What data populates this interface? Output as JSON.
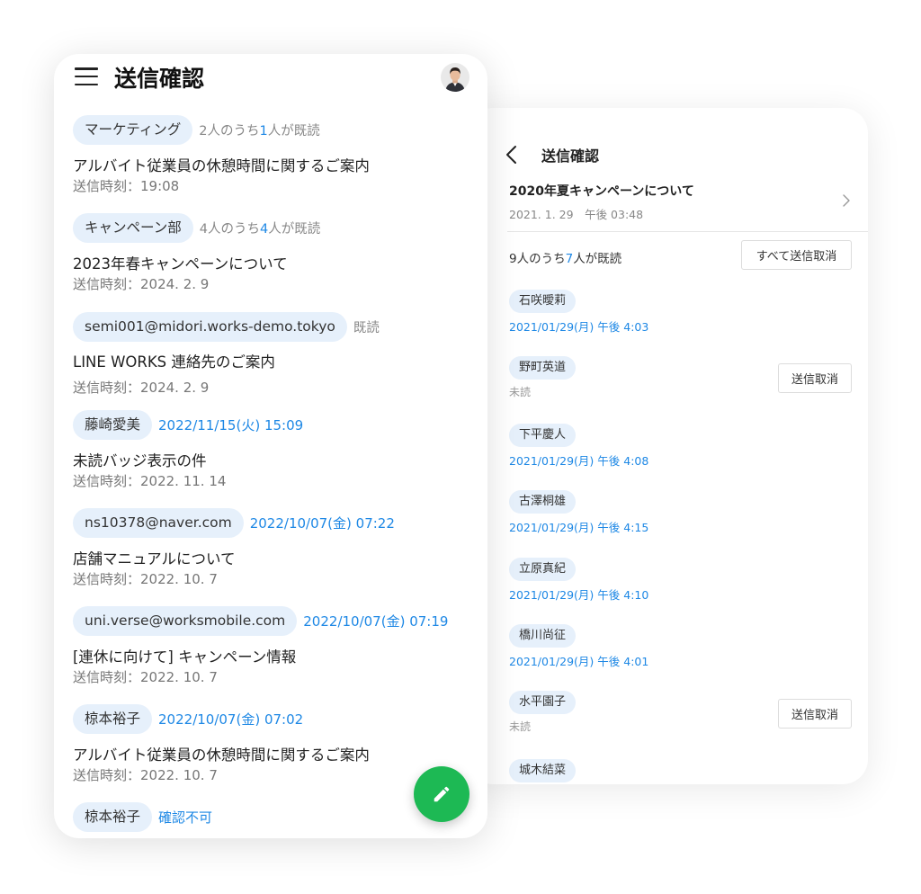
{
  "left_panel": {
    "title": "送信確認",
    "icons": {
      "menu": "hamburger-menu-icon",
      "avatar": "user-avatar",
      "compose": "pencil-icon"
    },
    "items": [
      {
        "recipient": "マーケティング",
        "status_pre": "2人のうち",
        "status_num": "1",
        "status_post": "人が既読",
        "subject": "アルバイト従業員の休憩時間に関するご案内",
        "sent": "送信時刻：19:08"
      },
      {
        "recipient": "キャンペーン部",
        "status_pre": "4人のうち",
        "status_num": "4",
        "status_post": "人が既読",
        "subject": "2023年春キャンペーンについて",
        "sent": "送信時刻：2024. 2. 9"
      },
      {
        "recipient": "semi001@midori.works-demo.tokyo",
        "status": "既読",
        "subject": "LINE WORKS 連絡先のご案内",
        "sent": "送信時刻：2024. 2. 9"
      },
      {
        "recipient": "藤崎愛美",
        "read_at": "2022/11/15(火) 15:09",
        "subject": "未読バッジ表示の件",
        "sent": "送信時刻：2022. 11. 14"
      },
      {
        "recipient": "ns10378@naver.com",
        "read_at": "2022/10/07(金) 07:22",
        "subject": "店舗マニュアルについて",
        "sent": "送信時刻：2022. 10. 7"
      },
      {
        "recipient": "uni.verse@worksmobile.com",
        "read_at": "2022/10/07(金) 07:19",
        "subject": "[連休に向けて] キャンペーン情報",
        "sent": "送信時刻：2022. 10. 7"
      },
      {
        "recipient": "椋本裕子",
        "read_at": "2022/10/07(金) 07:02",
        "subject": "アルバイト従業員の休憩時間に関するご案内",
        "sent": "送信時刻：2022. 10. 7"
      },
      {
        "recipient": "椋本裕子",
        "read_at": "確認不可"
      }
    ]
  },
  "right_panel": {
    "title": "送信確認",
    "icons": {
      "back": "chevron-left-icon",
      "detail": "chevron-right-icon"
    },
    "subject": "2020年夏キャンペーンについて",
    "date": "2021. 1. 29　午後 03:48",
    "read_pre": "9人のうち",
    "read_num": "7",
    "read_post": "人が既読",
    "cancel_all_label": "すべて送信取消",
    "cancel_label": "送信取消",
    "recipients": [
      {
        "name": "石咲曖莉",
        "time": "2021/01/29(月) 午後 4:03"
      },
      {
        "name": "野町英道",
        "status": "未読"
      },
      {
        "name": "下平慶人",
        "time": "2021/01/29(月) 午後 4:08"
      },
      {
        "name": "古澤桐雄",
        "time": "2021/01/29(月) 午後 4:15"
      },
      {
        "name": "立原真紀",
        "time": "2021/01/29(月) 午後 4:10"
      },
      {
        "name": "橋川尚征",
        "time": "2021/01/29(月) 午後 4:01"
      },
      {
        "name": "水平園子",
        "status": "未読"
      },
      {
        "name": "城木結菜"
      }
    ]
  },
  "colors": {
    "accent_blue": "#1e88e5",
    "pill_bg": "#e6f0fb",
    "fab_green": "#1db954"
  }
}
